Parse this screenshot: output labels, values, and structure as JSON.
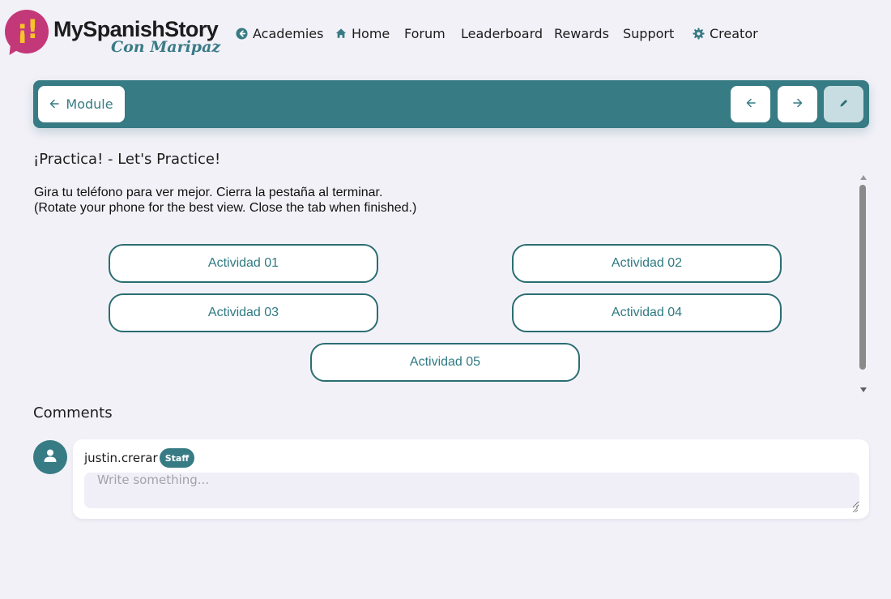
{
  "brand": {
    "mark": "¡!",
    "name": "MySpanishStory",
    "tagline": "Con Maripaz",
    "color_primary": "#c33878",
    "color_accent": "#f6c32a",
    "color_teal": "#377b84"
  },
  "nav": {
    "items": [
      {
        "label": "Academies",
        "icon": "arrow-circle-left-icon"
      },
      {
        "label": "Home",
        "icon": "home-icon"
      },
      {
        "label": "Forum"
      },
      {
        "label": "Leaderboard"
      },
      {
        "label": "Rewards"
      },
      {
        "label": "Support"
      },
      {
        "label": "Creator",
        "icon": "gear-icon"
      }
    ]
  },
  "toolbar": {
    "module_label": "Module",
    "prev_icon": "arrow-left-icon",
    "next_icon": "arrow-right-icon",
    "edit_icon": "pencil-icon"
  },
  "lesson": {
    "title": "¡Practica! - Let's Practice!",
    "instruction_es": "Gira tu teléfono para ver mejor. Cierra la pestaña al terminar.",
    "instruction_en": "(Rotate your phone for the best view. Close the tab when finished.)",
    "activities": [
      "Actividad 01",
      "Actividad 02",
      "Actividad 03",
      "Actividad 04",
      "Actividad 05"
    ]
  },
  "comments": {
    "title": "Comments",
    "user": "justin.crerar",
    "badge": "Staff",
    "placeholder": "Write something..."
  }
}
